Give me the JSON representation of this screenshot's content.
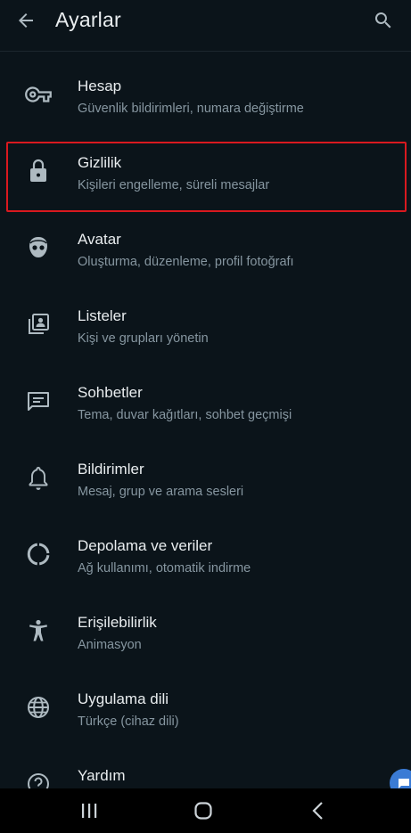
{
  "header": {
    "title": "Ayarlar"
  },
  "settings": [
    {
      "label": "Hesap",
      "sub": "Güvenlik bildirimleri, numara değiştirme"
    },
    {
      "label": "Gizlilik",
      "sub": "Kişileri engelleme, süreli mesajlar"
    },
    {
      "label": "Avatar",
      "sub": "Oluşturma, düzenleme, profil fotoğrafı"
    },
    {
      "label": "Listeler",
      "sub": "Kişi ve grupları yönetin"
    },
    {
      "label": "Sohbetler",
      "sub": "Tema, duvar kağıtları, sohbet geçmişi"
    },
    {
      "label": "Bildirimler",
      "sub": "Mesaj, grup ve arama sesleri"
    },
    {
      "label": "Depolama ve veriler",
      "sub": "Ağ kullanımı, otomatik indirme"
    },
    {
      "label": "Erişilebilirlik",
      "sub": "Animasyon"
    },
    {
      "label": "Uygulama dili",
      "sub": "Türkçe (cihaz dili)"
    },
    {
      "label": "Yardım",
      "sub": ""
    }
  ],
  "icons": [
    "key-icon",
    "lock-icon",
    "avatar-icon",
    "lists-icon",
    "chat-icon",
    "bell-icon",
    "storage-icon",
    "accessibility-icon",
    "globe-icon",
    "help-icon"
  ],
  "colors": {
    "background": "#0b141a",
    "text": "#e9edef",
    "subtext": "#8696a0",
    "icon": "#aebac1",
    "highlight_border": "#d9191f"
  }
}
